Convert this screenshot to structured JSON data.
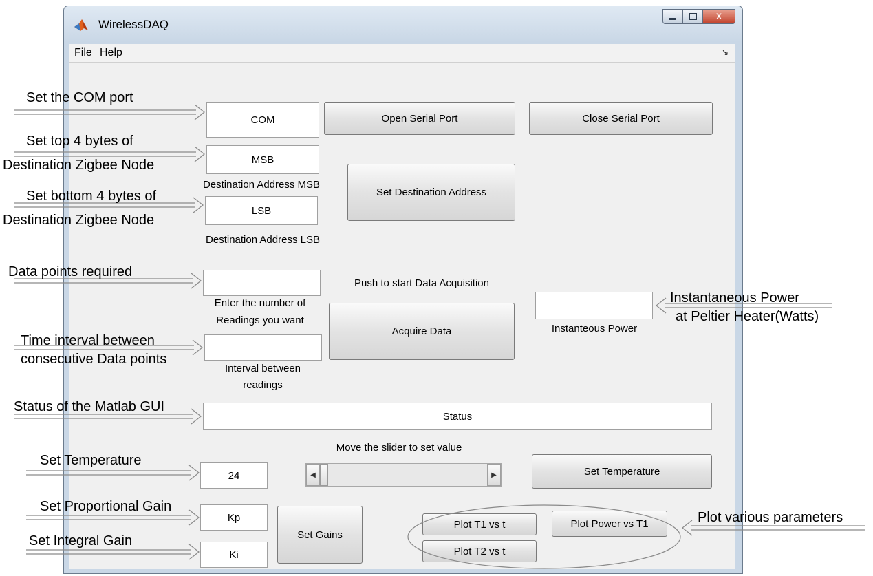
{
  "window": {
    "title": "WirelessDAQ",
    "buttons": {
      "minimize": "minimize-icon",
      "maximize": "maximize-icon",
      "close": "X"
    }
  },
  "menu": {
    "items": [
      "File",
      "Help"
    ]
  },
  "controls": {
    "com_field": "COM",
    "open_serial": "Open Serial Port",
    "close_serial": "Close Serial Port",
    "msb_field": "MSB",
    "msb_label": "Destination Address MSB",
    "lsb_field": "LSB",
    "lsb_label": "Destination Address LSB",
    "set_destination": "Set Destination Address",
    "push_label": "Push to start Data Acquisition",
    "readings_field": "",
    "readings_label_1": "Enter the number of",
    "readings_label_2": "Readings you want",
    "acquire": "Acquire Data",
    "interval_field": "",
    "interval_label_1": "Interval between",
    "interval_label_2": "readings",
    "power_field": "",
    "power_label": "Instanteous Power",
    "status": "Status",
    "slider_label": "Move the slider to set value",
    "temperature_field": "24",
    "set_temperature": "Set Temperature",
    "kp_field": "Kp",
    "ki_field": "Ki",
    "set_gains": "Set Gains",
    "plot_t1": "Plot T1 vs t",
    "plot_t2": "Plot T2 vs t",
    "plot_power": "Plot Power vs T1"
  },
  "annotations": {
    "com": "Set the COM port",
    "top_bytes_1": "Set top 4 bytes of",
    "top_bytes_2": "Destination Zigbee Node",
    "bottom_bytes_1": "Set bottom 4 bytes of",
    "bottom_bytes_2": "Destination Zigbee Node",
    "data_points": "Data points required",
    "interval_1": "Time interval between",
    "interval_2": "consecutive Data points",
    "status": "Status of the Matlab GUI",
    "temperature": "Set Temperature",
    "proportional": "Set Proportional Gain",
    "integral": "Set Integral Gain",
    "power_1": "Instantaneous Power",
    "power_2": "at Peltier Heater(Watts)",
    "plot": "Plot various parameters"
  },
  "colors": {
    "window_frame": "#c9d7e6",
    "client_bg": "#f0f0f0",
    "close_button": "#c2432d"
  }
}
